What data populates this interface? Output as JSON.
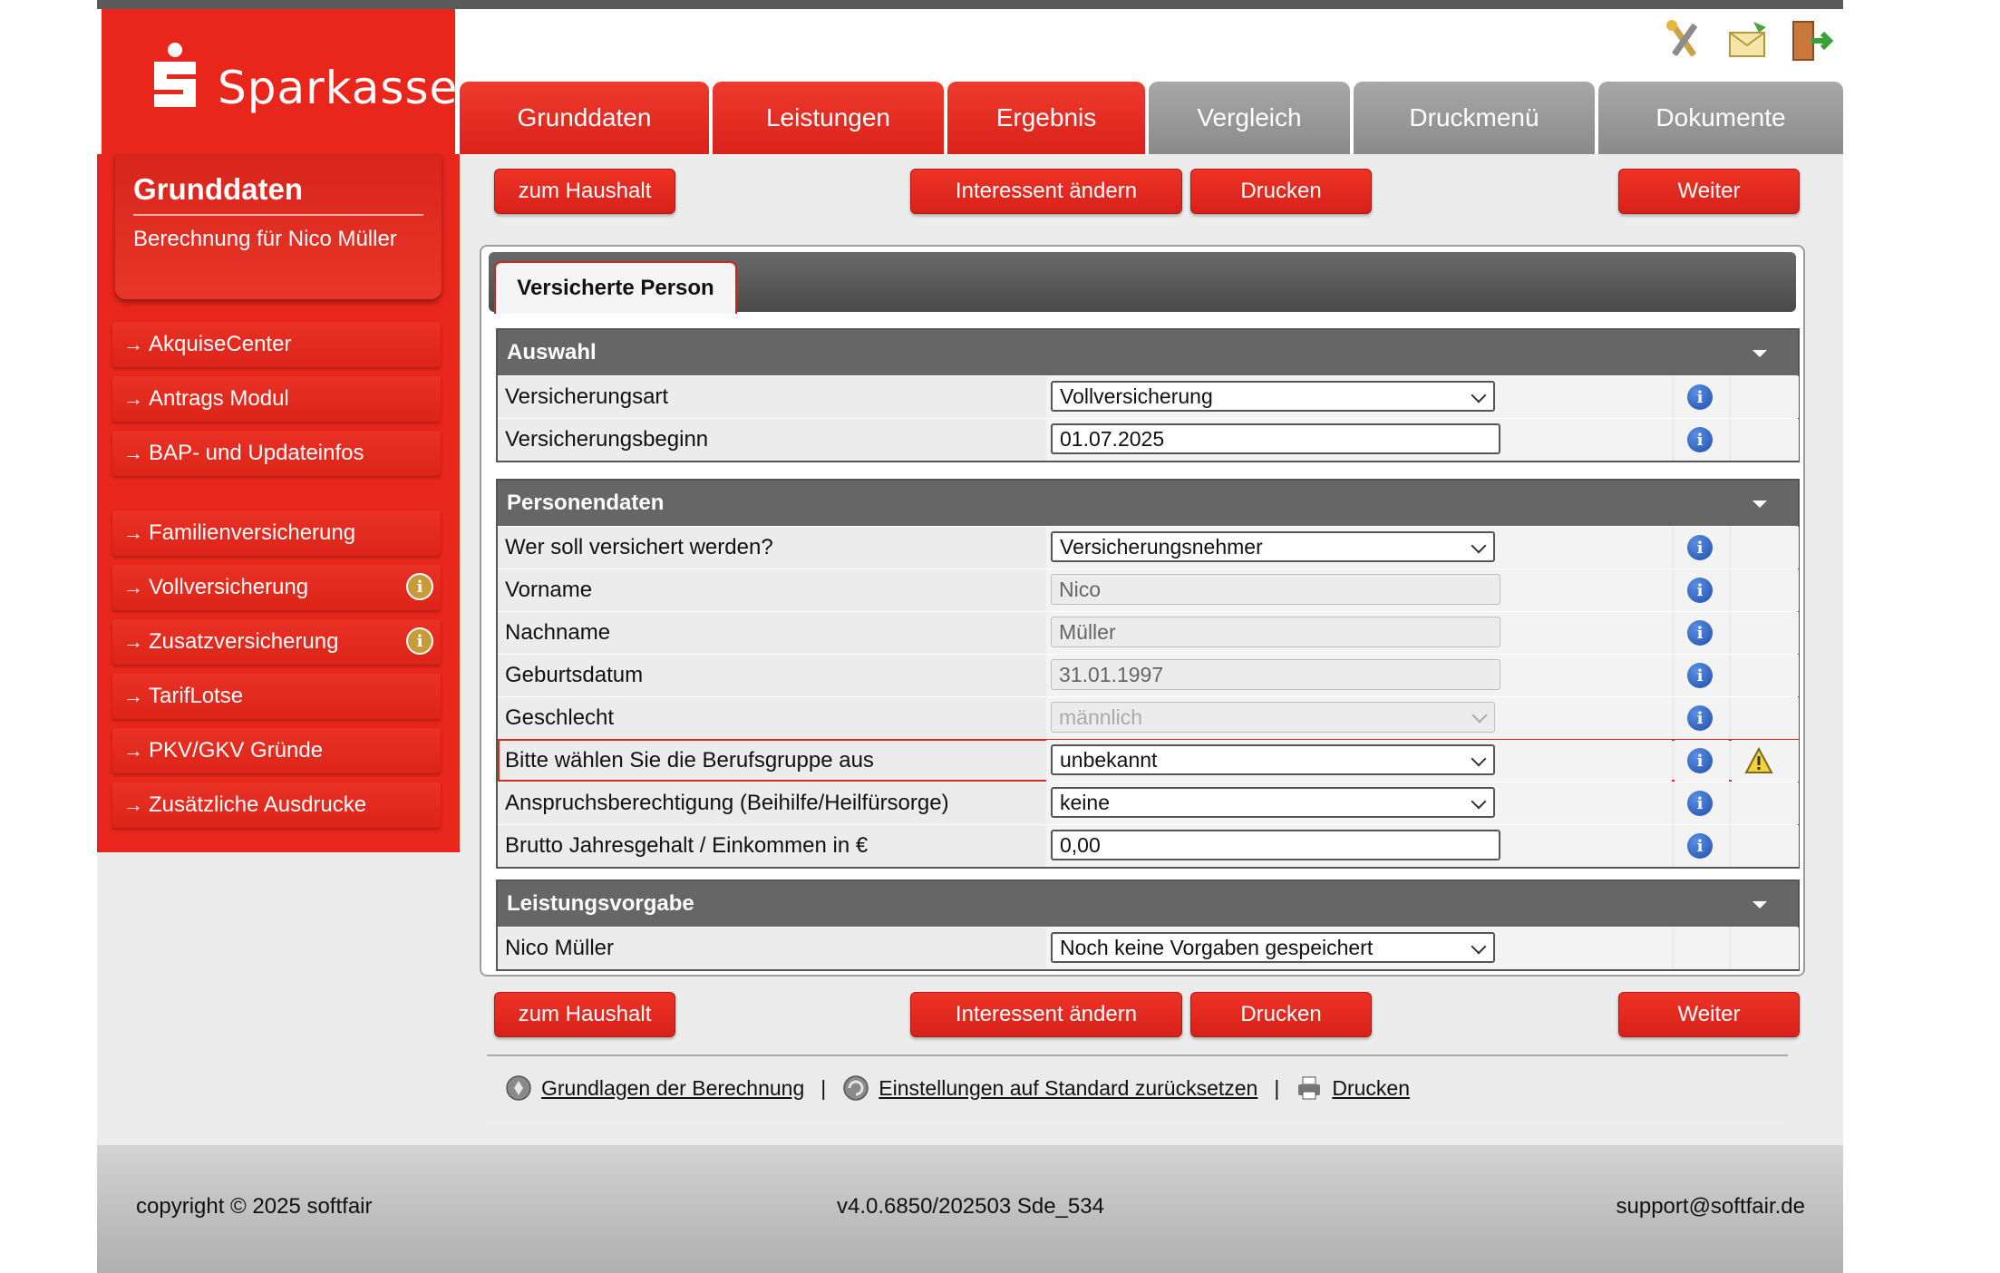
{
  "brand": {
    "name": "Sparkasse"
  },
  "tabs": [
    {
      "label": "Grunddaten",
      "state": "red"
    },
    {
      "label": "Leistungen",
      "state": "red"
    },
    {
      "label": "Ergebnis",
      "state": "red"
    },
    {
      "label": "Vergleich",
      "state": "grey"
    },
    {
      "label": "Druckmenü",
      "state": "grey"
    },
    {
      "label": "Dokumente",
      "state": "grey"
    }
  ],
  "header_icons": [
    "tools-icon",
    "email-icon",
    "exit-icon"
  ],
  "sidebar": {
    "title": "Grunddaten",
    "subtitle": "Berechnung für Nico Müller",
    "items": [
      {
        "label": "AkquiseCenter",
        "info": false
      },
      {
        "label": "Antrags Modul",
        "info": false
      },
      {
        "label": "BAP- und Updateinfos",
        "info": false
      },
      {
        "label": "Familienversicherung",
        "info": false
      },
      {
        "label": "Vollversicherung",
        "info": true
      },
      {
        "label": "Zusatzversicherung",
        "info": true
      },
      {
        "label": "TarifLotse",
        "info": false
      },
      {
        "label": "PKV/GKV Gründe",
        "info": false
      },
      {
        "label": "Zusätzliche Ausdrucke",
        "info": false
      }
    ]
  },
  "actions": {
    "haushalt": "zum Haushalt",
    "interessent": "Interessent ändern",
    "drucken": "Drucken",
    "weiter": "Weiter"
  },
  "panel_tab": "Versicherte Person",
  "sections": {
    "auswahl": {
      "title": "Auswahl",
      "rows": [
        {
          "label": "Versicherungsart",
          "value": "Vollversicherung"
        },
        {
          "label": "Versicherungsbeginn",
          "value": "01.07.2025"
        }
      ]
    },
    "personendaten": {
      "title": "Personendaten",
      "rows": [
        {
          "label": "Wer soll versichert werden?",
          "value": "Versicherungsnehmer"
        },
        {
          "label": "Vorname",
          "value": "Nico"
        },
        {
          "label": "Nachname",
          "value": "Müller"
        },
        {
          "label": "Geburtsdatum",
          "value": "31.01.1997"
        },
        {
          "label": "Geschlecht",
          "value": "männlich"
        },
        {
          "label": "Bitte wählen Sie die Berufsgruppe aus",
          "value": "unbekannt"
        },
        {
          "label": "Anspruchsberechtigung (Beihilfe/Heilfürsorge)",
          "value": "keine"
        },
        {
          "label": "Brutto Jahresgehalt / Einkommen in €",
          "value": "0,00"
        }
      ]
    },
    "leistungsvorgabe": {
      "title": "Leistungsvorgabe",
      "rows": [
        {
          "label": "Nico Müller",
          "value": "Noch keine Vorgaben gespeichert"
        }
      ]
    }
  },
  "footer_links": {
    "grundlagen": "Grundlagen der Berechnung",
    "reset": "Einstellungen auf Standard zurücksetzen",
    "drucken": "Drucken",
    "separator": "|"
  },
  "footer": {
    "copyright": "copyright © 2025 softfair",
    "version": "v4.0.6850/202503 Sde_534",
    "support": "support@softfair.de"
  },
  "colors": {
    "brand_red": "#e8261c",
    "tab_grey": "#8a8a8a",
    "section_grey": "#666666",
    "info_blue": "#1f4fae"
  }
}
